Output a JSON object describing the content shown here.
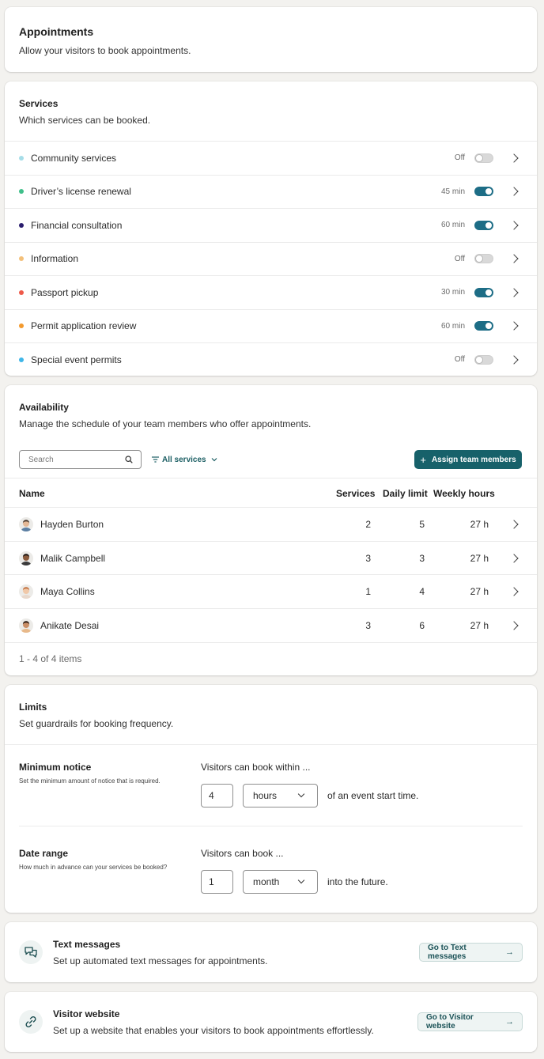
{
  "appointments": {
    "title": "Appointments",
    "subtitle": "Allow your visitors to book appointments."
  },
  "services": {
    "title": "Services",
    "subtitle": "Which services can be booked.",
    "items": [
      {
        "name": "Community services",
        "duration": "Off",
        "enabled": false,
        "color": "#a6dde8"
      },
      {
        "name": "Driver’s license renewal",
        "duration": "45 min",
        "enabled": true,
        "color": "#3fbf8a"
      },
      {
        "name": "Financial consultation",
        "duration": "60 min",
        "enabled": true,
        "color": "#2a1d6e"
      },
      {
        "name": "Information",
        "duration": "Off",
        "enabled": false,
        "color": "#f3c07a"
      },
      {
        "name": "Passport pickup",
        "duration": "30 min",
        "enabled": true,
        "color": "#ee5a4a"
      },
      {
        "name": "Permit application review",
        "duration": "60 min",
        "enabled": true,
        "color": "#f39a2e"
      },
      {
        "name": "Special event permits",
        "duration": "Off",
        "enabled": false,
        "color": "#3fb6e8"
      }
    ]
  },
  "availability": {
    "title": "Availability",
    "subtitle": "Manage the schedule of your team members who offer appointments.",
    "search_placeholder": "Search",
    "filter_label": "All services",
    "assign_label": "Assign team members",
    "columns": {
      "name": "Name",
      "services": "Services",
      "daily_limit": "Daily limit",
      "weekly_hours": "Weekly hours"
    },
    "members": [
      {
        "name": "Hayden Burton",
        "services": "2",
        "daily_limit": "5",
        "weekly_hours": "27 h",
        "skin": "#e4b896",
        "hair": "#4a3a2e",
        "shirt": "#5c7fa3"
      },
      {
        "name": "Malik Campbell",
        "services": "3",
        "daily_limit": "3",
        "weekly_hours": "27 h",
        "skin": "#8a5a3c",
        "hair": "#1e1612",
        "shirt": "#3a3a3a"
      },
      {
        "name": "Maya Collins",
        "services": "1",
        "daily_limit": "4",
        "weekly_hours": "27 h",
        "skin": "#f0c8a8",
        "hair": "#c2703e",
        "shirt": "#e8d8cc"
      },
      {
        "name": "Anikate Desai",
        "services": "3",
        "daily_limit": "6",
        "weekly_hours": "27 h",
        "skin": "#c98e66",
        "hair": "#2a1a12",
        "shirt": "#e8b98a"
      }
    ],
    "pagination": "1 - 4 of 4 items"
  },
  "limits": {
    "title": "Limits",
    "subtitle": "Set guardrails for booking frequency.",
    "minimum_notice": {
      "label": "Minimum notice",
      "description": "Set the minimum amount of notice that is required.",
      "prompt": "Visitors can book within ...",
      "value": "4",
      "unit": "hours",
      "suffix": "of an event start time."
    },
    "date_range": {
      "label": "Date range",
      "description": "How much in advance can your services be booked?",
      "prompt": "Visitors can book ...",
      "value": "1",
      "unit": "month",
      "suffix": "into the future."
    }
  },
  "text_messages": {
    "title": "Text messages",
    "subtitle": "Set up automated text messages for appointments.",
    "button": "Go to Text messages",
    "icon": "chat-bubbles-icon"
  },
  "visitor_website": {
    "title": "Visitor website",
    "subtitle": "Set up a website that enables your visitors to book appointments effortlessly.",
    "button": "Go to Visitor website",
    "icon": "link-icon"
  }
}
